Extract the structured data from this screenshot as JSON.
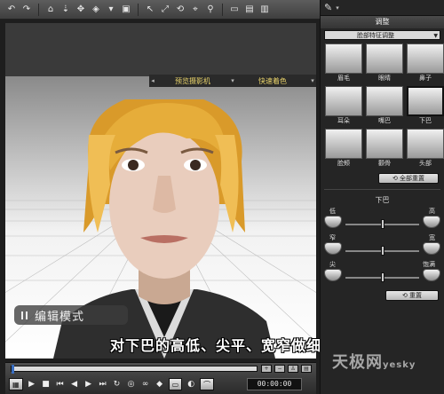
{
  "toolbar": {
    "buttons": [
      "undo-icon",
      "redo-icon",
      "home-icon",
      "move-down-icon",
      "move-icon",
      "view-icon",
      "select-icon",
      "frame-icon",
      "pointer-icon",
      "scale-icon",
      "rotate-icon",
      "target-icon",
      "bone-icon",
      "camera-icon",
      "screen-icon",
      "settings-icon"
    ]
  },
  "viewport": {
    "camera_bar": {
      "left": "预览摄影机",
      "right": "快速着色"
    },
    "mode_label": "编辑模式"
  },
  "caption": "对下巴的高低、尖平、宽窄做细微调整",
  "panel": {
    "title": "调整",
    "dropdown": "脸部特征调整",
    "features": [
      {
        "label": "眉毛",
        "selected": false
      },
      {
        "label": "眼睛",
        "selected": false
      },
      {
        "label": "鼻子",
        "selected": false
      },
      {
        "label": "耳朵",
        "selected": false
      },
      {
        "label": "嘴巴",
        "selected": false
      },
      {
        "label": "下巴",
        "selected": true
      },
      {
        "label": "脸颊",
        "selected": false
      },
      {
        "label": "颧骨",
        "selected": false
      },
      {
        "label": "头部",
        "selected": false
      }
    ],
    "reset_all": "全部重置",
    "group_title": "下巴",
    "sliders": [
      {
        "left": "低",
        "right": "高",
        "value": 0.5
      },
      {
        "left": "窄",
        "right": "宽",
        "value": 0.5
      },
      {
        "left": "尖",
        "right": "饱满",
        "value": 0.5
      }
    ],
    "reset": "重置"
  },
  "player": {
    "timecode": "00:00:00",
    "progress": 0.0,
    "buttons": [
      "play-icon",
      "stop-icon",
      "prev-icon",
      "prev-frame-icon",
      "next-frame-icon",
      "next-icon",
      "loop-icon"
    ]
  },
  "watermark": {
    "main": "天极网",
    "sub": "yesky"
  }
}
